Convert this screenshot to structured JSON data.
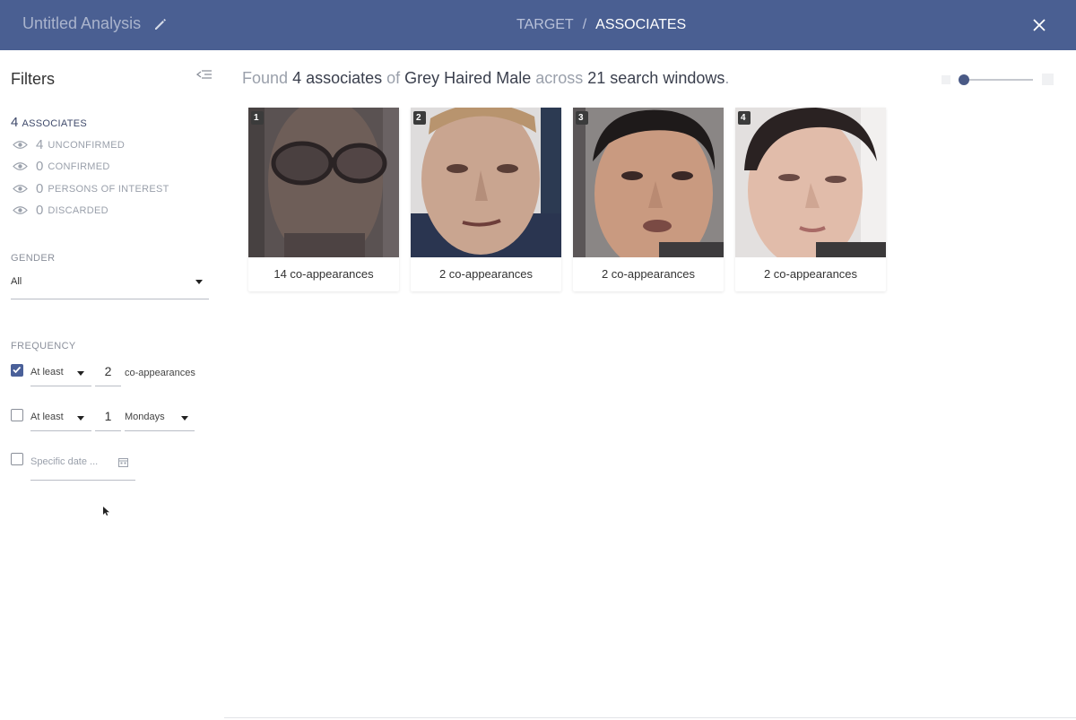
{
  "header": {
    "title": "Untitled Analysis",
    "breadcrumb": {
      "target": "TARGET",
      "separator": "/",
      "current": "ASSOCIATES"
    }
  },
  "sidebar": {
    "title": "Filters",
    "associates": {
      "count": "4",
      "label": "ASSOCIATES"
    },
    "stats": [
      {
        "count": "4",
        "label": "UNCONFIRMED"
      },
      {
        "count": "0",
        "label": "CONFIRMED"
      },
      {
        "count": "0",
        "label": "PERSONS OF INTEREST"
      },
      {
        "count": "0",
        "label": "DISCARDED"
      }
    ],
    "gender": {
      "label": "GENDER",
      "value": "All"
    },
    "frequency": {
      "label": "FREQUENCY",
      "rows": [
        {
          "checked": true,
          "qualifier": "At least",
          "value": "2",
          "unit": "co-appearances"
        },
        {
          "checked": false,
          "qualifier": "At least",
          "value": "1",
          "unit": "Mondays"
        }
      ],
      "specific_date": {
        "checked": false,
        "placeholder": "Specific date ..."
      }
    }
  },
  "main": {
    "summary": {
      "found": "Found",
      "count": "4 associates",
      "of": "of",
      "target": "Grey Haired Male",
      "across": "across",
      "windows": "21 search windows",
      "period": "."
    },
    "thumbnail_size": 0.0,
    "cards": [
      {
        "index": "1",
        "caption": "14 co-appearances"
      },
      {
        "index": "2",
        "caption": "2 co-appearances"
      },
      {
        "index": "3",
        "caption": "2 co-appearances"
      },
      {
        "index": "4",
        "caption": "2 co-appearances"
      }
    ]
  },
  "colors": {
    "header_bg": "#4a5f92",
    "accent": "#4a6099"
  },
  "icons": {
    "edit": "pencil-icon",
    "close": "close-icon",
    "collapse": "collapse-sidebar-icon",
    "eye": "eye-icon",
    "calendar": "calendar-icon",
    "dropdown": "chevron-down-icon"
  }
}
